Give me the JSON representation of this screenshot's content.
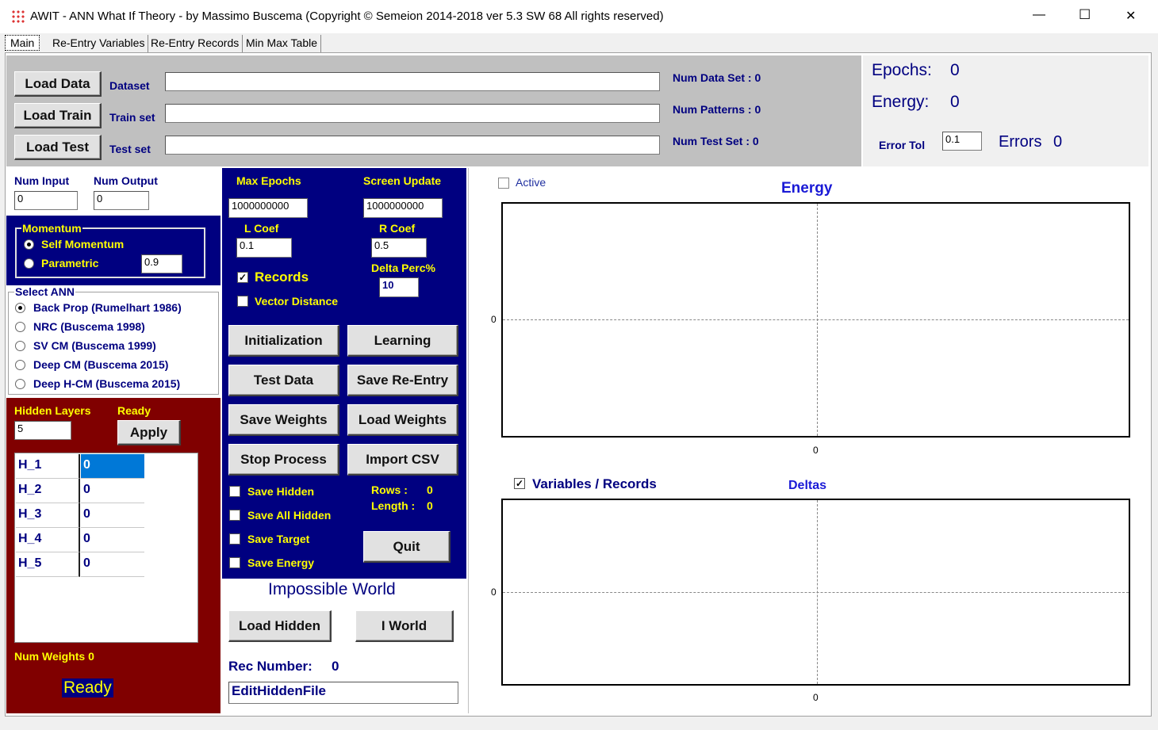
{
  "window": {
    "title": "AWIT - ANN What If Theory  - by Massimo Buscema (Copyright © Semeion 2014-2018 ver 5.3  SW 68  All rights reserved)",
    "minimize": "—",
    "maximize": "☐",
    "close": "✕"
  },
  "tabs": [
    {
      "label": "Main",
      "active": true
    },
    {
      "label": "Re-Entry Variables"
    },
    {
      "label": "Re-Entry Records"
    },
    {
      "label": "Min Max Table"
    }
  ],
  "top": {
    "load_data": "Load Data",
    "load_train": "Load Train",
    "load_test": "Load Test",
    "dataset_label": "Dataset",
    "train_label": "Train set",
    "test_label": "Test set",
    "dataset_value": "",
    "train_value": "",
    "test_value": "",
    "num_data_set": "Num Data Set : 0",
    "num_patterns": "Num Patterns : 0",
    "num_test_set": "Num Test Set : 0"
  },
  "status": {
    "epochs_label": "Epochs:",
    "epochs_value": "0",
    "energy_label": "Energy:",
    "energy_value": "0",
    "error_tol_label": "Error Tol",
    "error_tol_value": "0.1",
    "errors_label": "Errors",
    "errors_value": "0"
  },
  "io": {
    "num_input_label": "Num Input",
    "num_input_value": "0",
    "num_output_label": "Num Output",
    "num_output_value": "0"
  },
  "momentum": {
    "title": "Momentum",
    "options": [
      "Self Momentum",
      "Parametric"
    ],
    "selected": "Self Momentum",
    "value": "0.9"
  },
  "ann": {
    "title": "Select ANN",
    "options": [
      "Back Prop (Rumelhart 1986)",
      "NRC (Buscema 1998)",
      "SV CM (Buscema 1999)",
      "Deep CM (Buscema 2015)",
      "Deep H-CM (Buscema 2015)"
    ],
    "selected": "Back Prop (Rumelhart 1986)"
  },
  "hidden": {
    "title": "Hidden Layers",
    "ready": "Ready",
    "count": "5",
    "apply": "Apply",
    "rows": [
      {
        "name": "H_1",
        "value": "0"
      },
      {
        "name": "H_2",
        "value": "0"
      },
      {
        "name": "H_3",
        "value": "0"
      },
      {
        "name": "H_4",
        "value": "0"
      },
      {
        "name": "H_5",
        "value": "0"
      }
    ],
    "num_weights": "Num Weights 0",
    "status": "Ready"
  },
  "params": {
    "max_epochs_label": "Max Epochs",
    "max_epochs_value": "1000000000",
    "screen_update_label": "Screen Update",
    "screen_update_value": "1000000000",
    "l_coef_label": "L Coef",
    "l_coef_value": "0.1",
    "r_coef_label": "R Coef",
    "r_coef_value": "0.5",
    "records_label": "Records",
    "vector_distance_label": "Vector Distance",
    "delta_perc_label": "Delta Perc%",
    "delta_perc_value": "10"
  },
  "actions": {
    "initialization": "Initialization",
    "learning": "Learning",
    "test_data": "Test Data",
    "save_reentry": "Save Re-Entry",
    "save_weights": "Save Weights",
    "load_weights": "Load Weights",
    "stop_process": "Stop Process",
    "import_csv": "Import CSV",
    "save_hidden": "Save Hidden",
    "save_all_hidden": "Save All Hidden",
    "save_target": "Save Target",
    "save_energy": "Save Energy",
    "rows_label": "Rows :",
    "rows_value": "0",
    "length_label": "Length :",
    "length_value": "0",
    "quit": "Quit"
  },
  "impossible": {
    "title": "Impossible World",
    "load_hidden": "Load Hidden",
    "i_world": "I World",
    "rec_number_label": "Rec Number:",
    "rec_number_value": "0",
    "edit_hidden_file": "EditHiddenFile"
  },
  "charts": {
    "active_label": "Active",
    "energy_title": "Energy",
    "energy_y_tick": "0",
    "energy_x_tick": "0",
    "var_records_label": "Variables / Records",
    "deltas_title": "Deltas",
    "deltas_y_tick": "0",
    "deltas_x_tick": "0"
  }
}
